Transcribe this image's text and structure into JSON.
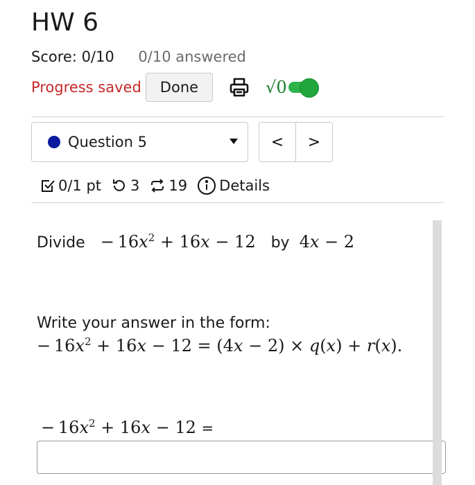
{
  "assignment": {
    "title": "HW 6",
    "score": "Score: 0/10",
    "answered": "0/10 answered",
    "progress_status": "Progress saved",
    "done_label": "Done",
    "math_toggle_label": "√0"
  },
  "question_nav": {
    "selected_question": "Question 5",
    "prev_label": "<",
    "next_label": ">"
  },
  "question_meta": {
    "points": "0/1 pt",
    "retries": "3",
    "submissions": "19",
    "details_label": "Details"
  },
  "question": {
    "divide_word": "Divide",
    "by_word": "by",
    "form_instruction": "Write your answer in the form:",
    "answer_value": ""
  },
  "colors": {
    "progress_saved": "#c62828",
    "toggle_on": "#2db34a",
    "question_dot": "#0a1a9e"
  }
}
